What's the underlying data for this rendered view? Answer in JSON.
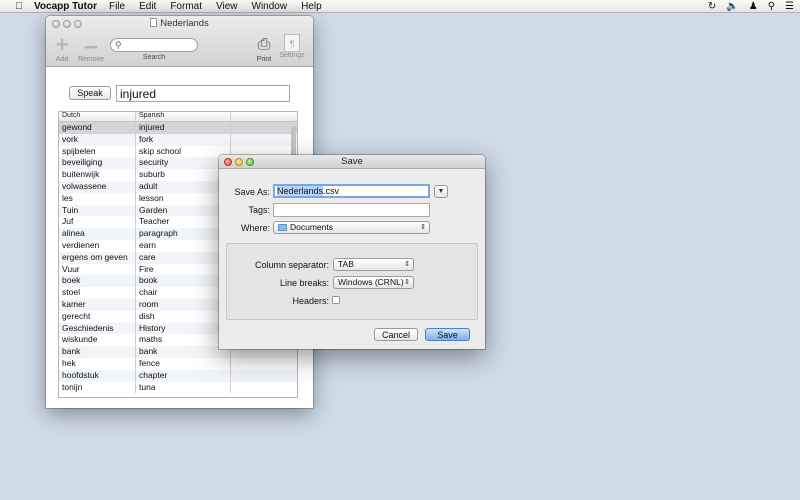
{
  "menubar": {
    "apple_icon": "apple-logo-icon",
    "app_name": "Vocapp Tutor",
    "menus": [
      "File",
      "Edit",
      "Format",
      "View",
      "Window",
      "Help"
    ],
    "status_icons": [
      "time-machine-icon",
      "volume-icon",
      "user-icon",
      "spotlight-search-icon",
      "notification-list-icon"
    ]
  },
  "main_window": {
    "title": "Nederlands",
    "toolbar": {
      "add_label": "Add",
      "remove_label": "Remove",
      "search_label": "Search",
      "search_value": "",
      "search_placeholder": "",
      "print_label": "Print",
      "settings_label": "Settings"
    },
    "speak_label": "Speak",
    "current_word": "injured",
    "table": {
      "columns": [
        "Dutch",
        "Spanish",
        ""
      ],
      "rows": [
        [
          "gewond",
          "injured"
        ],
        [
          "vork",
          "fork"
        ],
        [
          "spijbelen",
          "skip school"
        ],
        [
          "beveiliging",
          "security"
        ],
        [
          "buitenwijk",
          "suburb"
        ],
        [
          "volwassene",
          "adult"
        ],
        [
          "les",
          "lesson"
        ],
        [
          "Tuin",
          "Garden"
        ],
        [
          "Juf",
          "Teacher"
        ],
        [
          "alinea",
          "paragraph"
        ],
        [
          "verdienen",
          "earn"
        ],
        [
          "ergens om geven",
          "care"
        ],
        [
          "Vuur",
          "Fire"
        ],
        [
          "boek",
          "book"
        ],
        [
          "stoel",
          "chair"
        ],
        [
          "kamer",
          "room"
        ],
        [
          "gerecht",
          "dish"
        ],
        [
          "Geschiedenis",
          "History"
        ],
        [
          "wiskunde",
          "maths"
        ],
        [
          "bank",
          "bank"
        ],
        [
          "hek",
          "fence"
        ],
        [
          "hoofdstuk",
          "chapter"
        ],
        [
          "tonijn",
          "tuna"
        ]
      ],
      "selected_index": 0
    }
  },
  "save_dialog": {
    "title": "Save",
    "save_as_label": "Save As:",
    "filename_selected": "Nederlands",
    "filename_ext": ".csv",
    "tags_label": "Tags:",
    "tags_value": "",
    "where_label": "Where:",
    "where_value": "Documents",
    "column_separator_label": "Column separator:",
    "column_separator_value": "TAB",
    "line_breaks_label": "Line breaks:",
    "line_breaks_value": "Windows (CRNL)",
    "headers_label": "Headers:",
    "headers_checked": false,
    "cancel_label": "Cancel",
    "save_label": "Save"
  },
  "colors": {
    "desktop": "#cfdbe9",
    "selection": "#b7d4fb",
    "default_button": "#7fb0ef"
  }
}
